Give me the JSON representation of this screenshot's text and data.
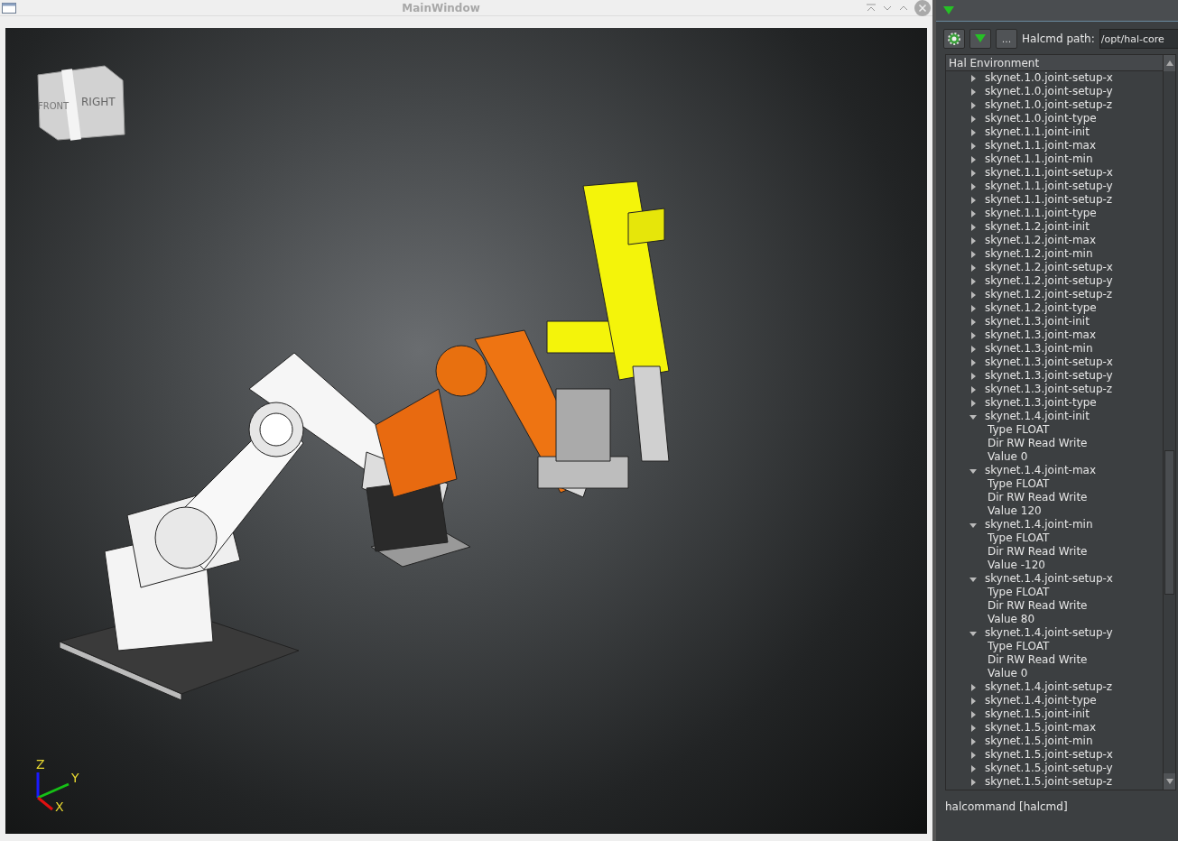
{
  "window": {
    "title": "MainWindow"
  },
  "viewport": {
    "view_cube": {
      "faces": [
        "FRONT",
        "RIGHT"
      ]
    },
    "axes": [
      "Z",
      "Y",
      "X"
    ]
  },
  "hal_panel": {
    "toolbar": {
      "browse_label": "...",
      "path_label": "Halcmd path:",
      "path_value": "/opt/hal-core"
    },
    "tree": {
      "header": "Hal Environment",
      "items": [
        {
          "label": "skynet.1.0.joint-setup-x",
          "expanded": false
        },
        {
          "label": "skynet.1.0.joint-setup-y",
          "expanded": false
        },
        {
          "label": "skynet.1.0.joint-setup-z",
          "expanded": false
        },
        {
          "label": "skynet.1.0.joint-type",
          "expanded": false
        },
        {
          "label": "skynet.1.1.joint-init",
          "expanded": false
        },
        {
          "label": "skynet.1.1.joint-max",
          "expanded": false
        },
        {
          "label": "skynet.1.1.joint-min",
          "expanded": false
        },
        {
          "label": "skynet.1.1.joint-setup-x",
          "expanded": false
        },
        {
          "label": "skynet.1.1.joint-setup-y",
          "expanded": false
        },
        {
          "label": "skynet.1.1.joint-setup-z",
          "expanded": false
        },
        {
          "label": "skynet.1.1.joint-type",
          "expanded": false
        },
        {
          "label": "skynet.1.2.joint-init",
          "expanded": false
        },
        {
          "label": "skynet.1.2.joint-max",
          "expanded": false
        },
        {
          "label": "skynet.1.2.joint-min",
          "expanded": false
        },
        {
          "label": "skynet.1.2.joint-setup-x",
          "expanded": false
        },
        {
          "label": "skynet.1.2.joint-setup-y",
          "expanded": false
        },
        {
          "label": "skynet.1.2.joint-setup-z",
          "expanded": false
        },
        {
          "label": "skynet.1.2.joint-type",
          "expanded": false
        },
        {
          "label": "skynet.1.3.joint-init",
          "expanded": false
        },
        {
          "label": "skynet.1.3.joint-max",
          "expanded": false
        },
        {
          "label": "skynet.1.3.joint-min",
          "expanded": false
        },
        {
          "label": "skynet.1.3.joint-setup-x",
          "expanded": false
        },
        {
          "label": "skynet.1.3.joint-setup-y",
          "expanded": false
        },
        {
          "label": "skynet.1.3.joint-setup-z",
          "expanded": false
        },
        {
          "label": "skynet.1.3.joint-type",
          "expanded": false
        },
        {
          "label": "skynet.1.4.joint-init",
          "expanded": true,
          "children": [
            {
              "label": "Type FLOAT"
            },
            {
              "label": "Dir RW Read Write"
            },
            {
              "label": "Value 0"
            }
          ]
        },
        {
          "label": "skynet.1.4.joint-max",
          "expanded": true,
          "children": [
            {
              "label": "Type FLOAT"
            },
            {
              "label": "Dir RW Read Write"
            },
            {
              "label": "Value 120"
            }
          ]
        },
        {
          "label": "skynet.1.4.joint-min",
          "expanded": true,
          "children": [
            {
              "label": "Type FLOAT"
            },
            {
              "label": "Dir RW Read Write"
            },
            {
              "label": "Value -120"
            }
          ]
        },
        {
          "label": "skynet.1.4.joint-setup-x",
          "expanded": true,
          "children": [
            {
              "label": "Type FLOAT"
            },
            {
              "label": "Dir RW Read Write"
            },
            {
              "label": "Value 80"
            }
          ]
        },
        {
          "label": "skynet.1.4.joint-setup-y",
          "expanded": true,
          "children": [
            {
              "label": "Type FLOAT"
            },
            {
              "label": "Dir RW Read Write"
            },
            {
              "label": "Value 0"
            }
          ]
        },
        {
          "label": "skynet.1.4.joint-setup-z",
          "expanded": false
        },
        {
          "label": "skynet.1.4.joint-type",
          "expanded": false
        },
        {
          "label": "skynet.1.5.joint-init",
          "expanded": false
        },
        {
          "label": "skynet.1.5.joint-max",
          "expanded": false
        },
        {
          "label": "skynet.1.5.joint-min",
          "expanded": false
        },
        {
          "label": "skynet.1.5.joint-setup-x",
          "expanded": false
        },
        {
          "label": "skynet.1.5.joint-setup-y",
          "expanded": false
        },
        {
          "label": "skynet.1.5.joint-setup-z",
          "expanded": false
        }
      ]
    },
    "status": "halcommand [halcmd]"
  }
}
